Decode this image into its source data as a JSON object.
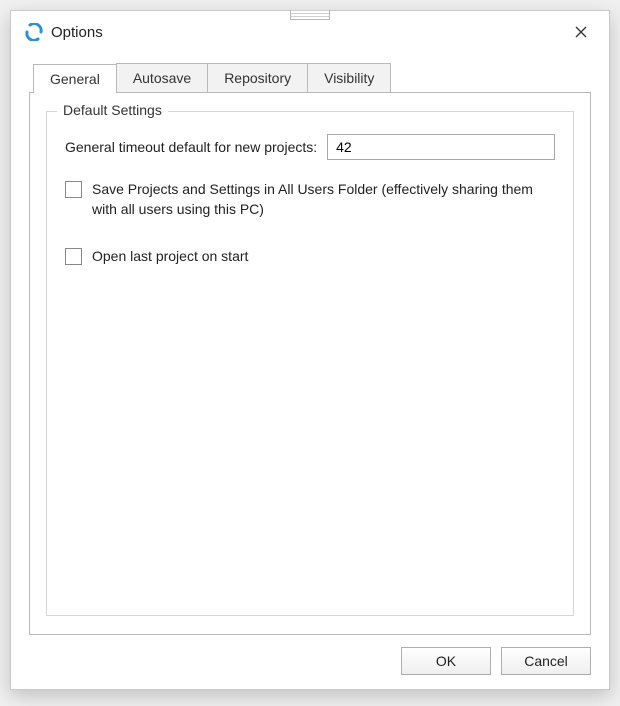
{
  "window": {
    "title": "Options",
    "icon_name": "options-app-icon"
  },
  "tabs": [
    {
      "label": "General",
      "active": true
    },
    {
      "label": "Autosave",
      "active": false
    },
    {
      "label": "Repository",
      "active": false
    },
    {
      "label": "Visibility",
      "active": false
    }
  ],
  "group": {
    "legend": "Default Settings",
    "timeout_label": "General timeout default for new projects:",
    "timeout_value": "42",
    "save_all_users_label": "Save Projects and Settings in All Users Folder (effectively sharing them with all users using this PC)",
    "save_all_users_checked": false,
    "open_last_label": "Open last project on start",
    "open_last_checked": false
  },
  "buttons": {
    "ok": "OK",
    "cancel": "Cancel"
  }
}
